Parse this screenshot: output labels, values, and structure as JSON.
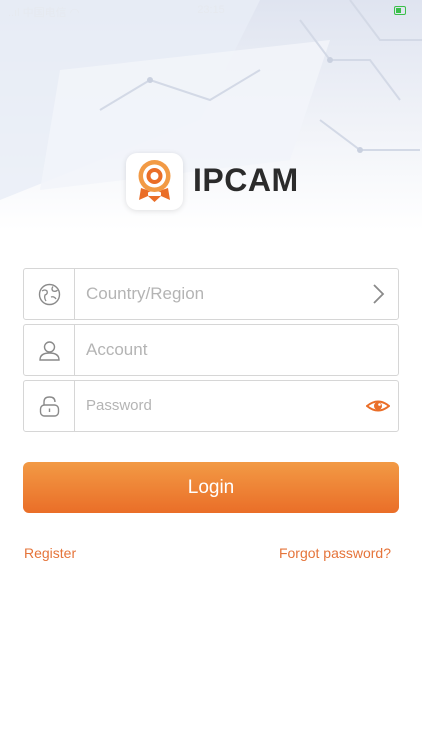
{
  "status_bar": {
    "carrier": "中国电信",
    "time": "23:15"
  },
  "brand": {
    "app_name": "IPCAM",
    "icon_name": "ipcam-logo-icon"
  },
  "form": {
    "country": {
      "placeholder": "Country/Region",
      "icon": "globe-icon",
      "trailing_icon": "chevron-right-icon"
    },
    "account": {
      "placeholder": "Account",
      "icon": "user-icon"
    },
    "password": {
      "placeholder": "Password",
      "icon": "lock-icon",
      "trailing_icon": "eye-icon"
    }
  },
  "actions": {
    "login_label": "Login",
    "register_label": "Register",
    "forgot_label": "Forgot password?"
  },
  "colors": {
    "accent": "#ea6e28",
    "accent_light": "#f29a45",
    "border": "#d6d6d6",
    "placeholder": "#b4b4b4"
  }
}
